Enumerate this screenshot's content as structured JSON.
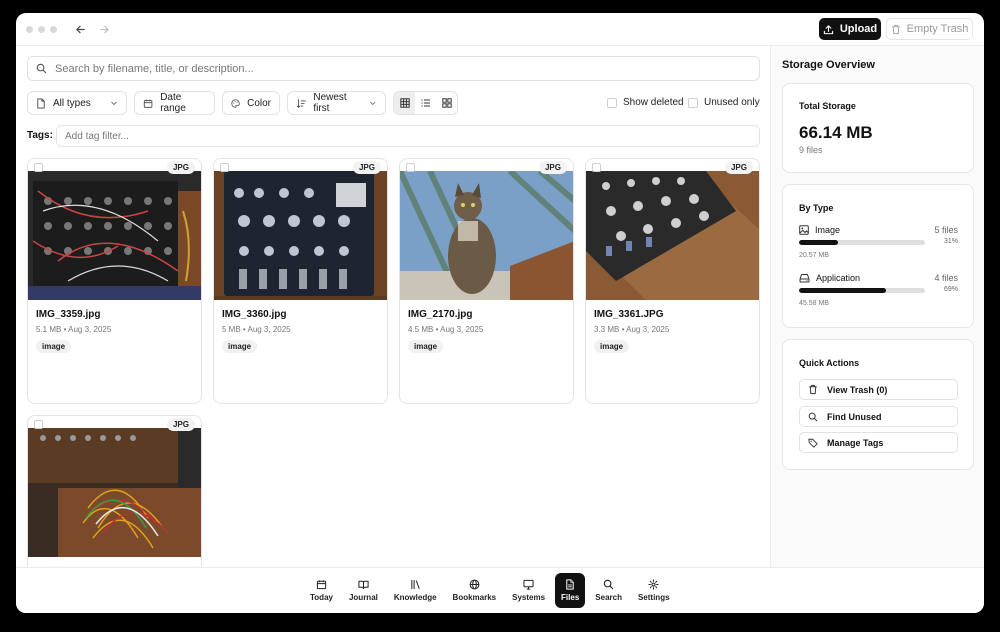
{
  "toolbar": {
    "upload_label": "Upload",
    "empty_trash_label": "Empty Trash"
  },
  "search": {
    "placeholder": "Search by filename, title, or description..."
  },
  "filters": {
    "types_label": "All types",
    "date_label": "Date range",
    "color_label": "Color",
    "sort_label": "Newest first",
    "show_deleted_label": "Show deleted",
    "unused_only_label": "Unused only"
  },
  "tags": {
    "label": "Tags:",
    "placeholder": "Add tag filter..."
  },
  "files": [
    {
      "badge": "JPG",
      "name": "IMG_3359.jpg",
      "meta": "5.1 MB • Aug 3, 2025",
      "tag": "image"
    },
    {
      "badge": "JPG",
      "name": "IMG_3360.jpg",
      "meta": "5 MB • Aug 3, 2025",
      "tag": "image"
    },
    {
      "badge": "JPG",
      "name": "IMG_2170.jpg",
      "meta": "4.5 MB • Aug 3, 2025",
      "tag": "image"
    },
    {
      "badge": "JPG",
      "name": "IMG_3361.JPG",
      "meta": "3.3 MB • Aug 3, 2025",
      "tag": "image"
    },
    {
      "badge": "JPG",
      "name": "",
      "meta": "",
      "tag": ""
    }
  ],
  "sidebar": {
    "title": "Storage Overview",
    "total": {
      "title": "Total Storage",
      "value": "66.14 MB",
      "files": "9 files"
    },
    "by_type": {
      "title": "By Type",
      "items": [
        {
          "name": "Image",
          "count": "5 files",
          "percent": "31%",
          "fraction": 0.31,
          "size": "20.57 MB"
        },
        {
          "name": "Application",
          "count": "4 files",
          "percent": "69%",
          "fraction": 0.69,
          "size": "45.58 MB"
        }
      ]
    },
    "quick_actions": {
      "title": "Quick Actions",
      "items": [
        "View Trash (0)",
        "Find Unused",
        "Manage Tags"
      ]
    }
  },
  "nav": [
    "Today",
    "Journal",
    "Knowledge",
    "Bookmarks",
    "Systems",
    "Files",
    "Search",
    "Settings"
  ],
  "nav_active": "Files"
}
